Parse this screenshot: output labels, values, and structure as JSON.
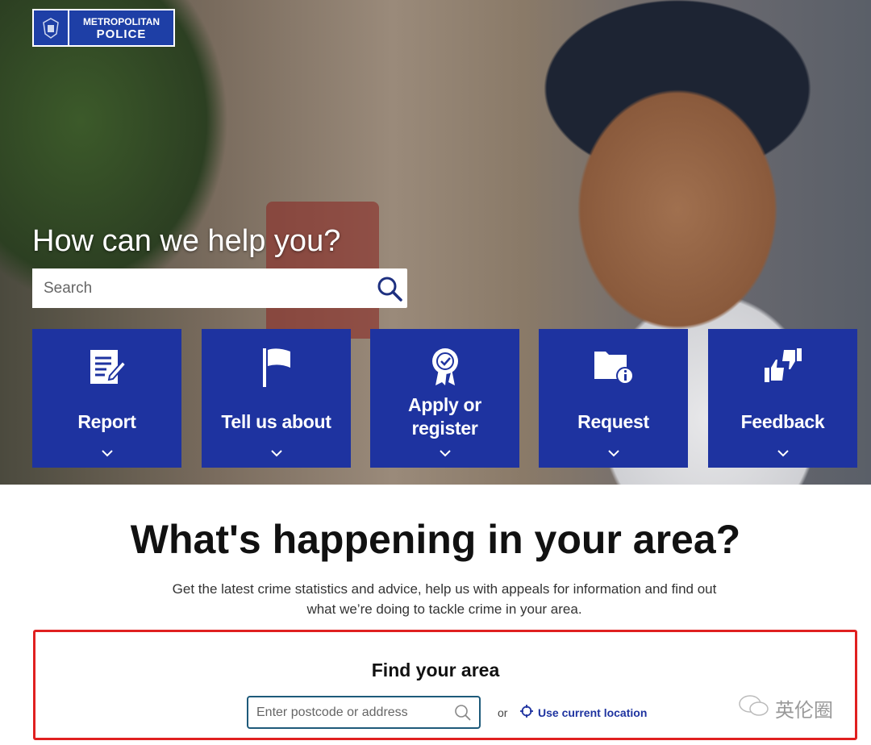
{
  "header": {
    "logo_line1": "METROPOLITAN",
    "logo_line2": "POLICE"
  },
  "hero": {
    "title": "How can we help you?",
    "search_placeholder": "Search"
  },
  "tiles": [
    {
      "label": "Report",
      "icon": "report-document-icon"
    },
    {
      "label": "Tell us about",
      "icon": "flag-icon"
    },
    {
      "label": "Apply or register",
      "icon": "badge-rosette-icon"
    },
    {
      "label": "Request",
      "icon": "folder-info-icon"
    },
    {
      "label": "Feedback",
      "icon": "thumbs-up-down-icon"
    }
  ],
  "area": {
    "title": "What's happening in your area?",
    "intro": "Get the latest crime statistics and advice, help us with appeals for information and find out what we’re doing to tackle crime in your area.",
    "find_title": "Find your area",
    "postcode_placeholder": "Enter postcode or address",
    "or_label": "or",
    "location_label": "Use current location"
  },
  "watermark": "英伦圈",
  "colors": {
    "brand_blue": "#1e33a0",
    "highlight_red": "#e02020"
  }
}
